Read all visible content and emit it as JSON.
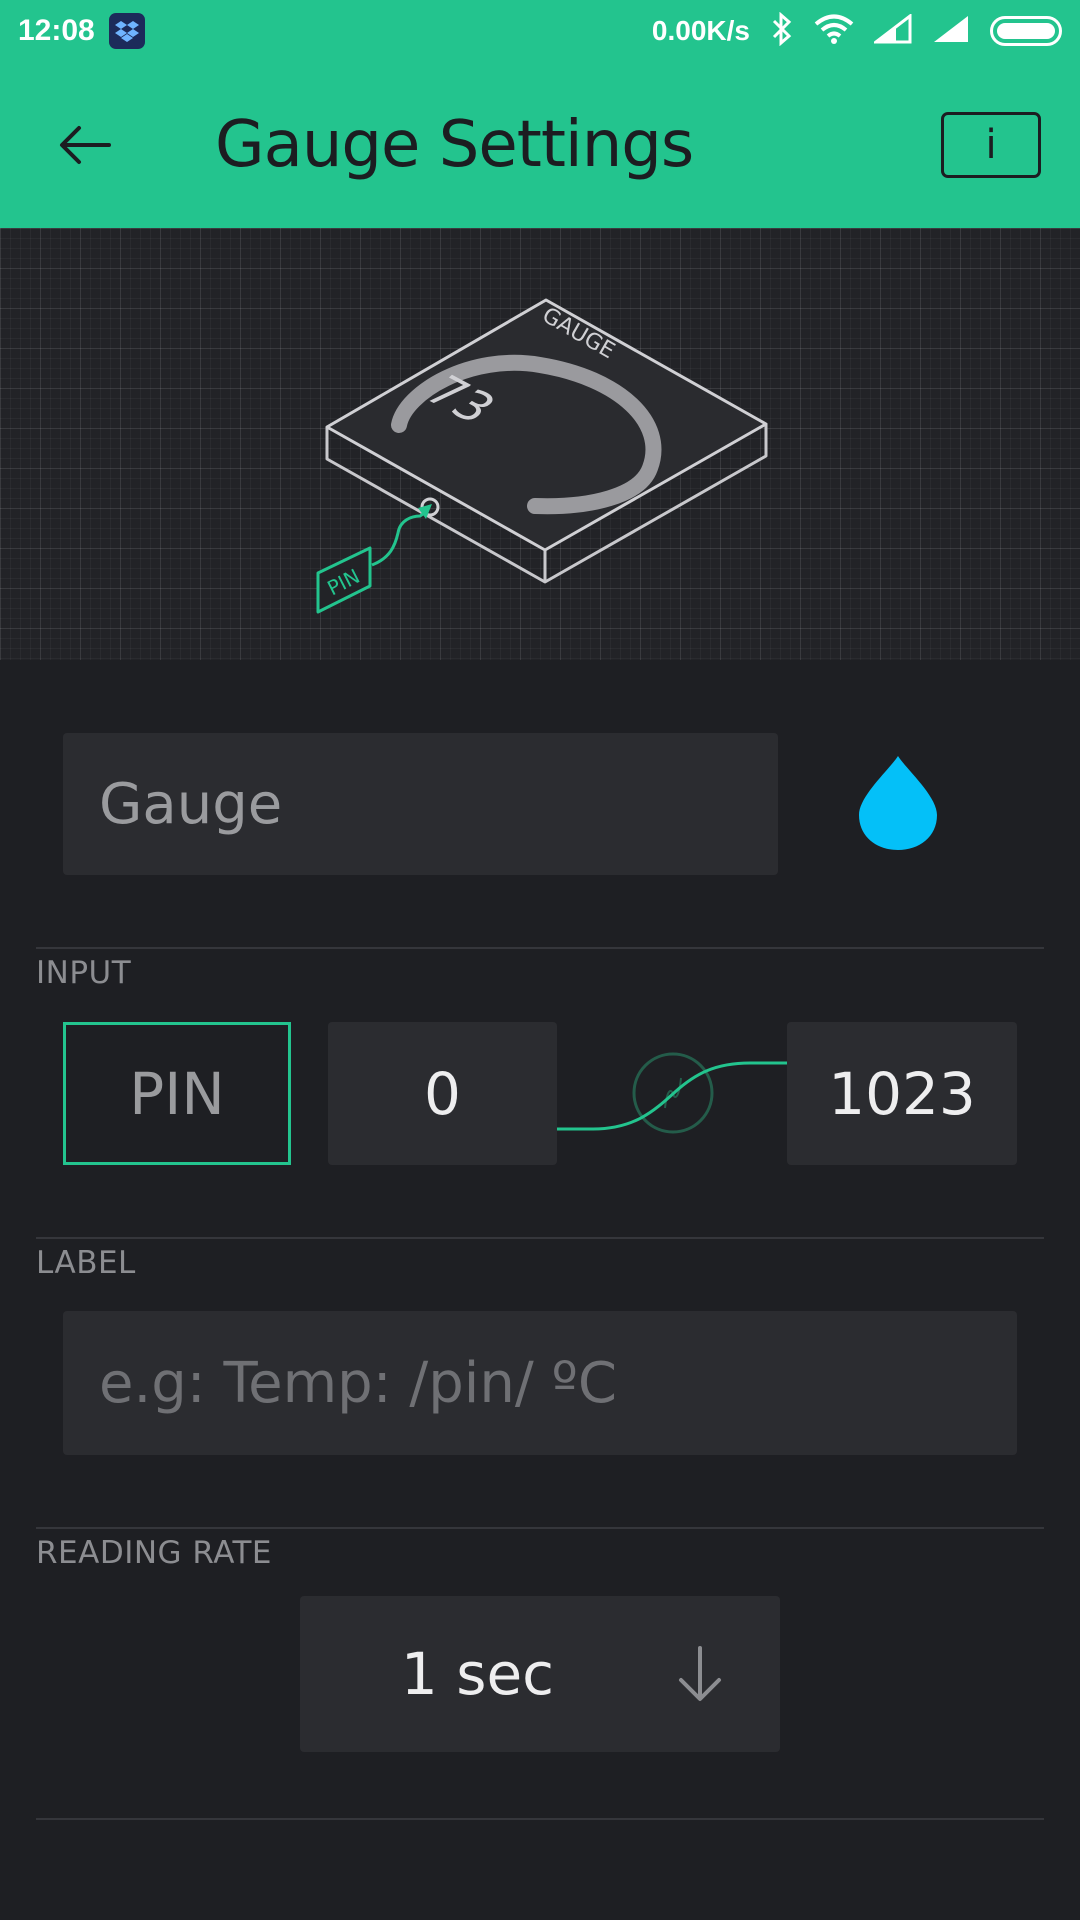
{
  "status_bar": {
    "time": "12:08",
    "app_icon": "dropbox-icon",
    "net_speed": "0.00K/s",
    "icons": [
      "bluetooth-icon",
      "wifi-icon",
      "signal-icon",
      "signal-icon",
      "battery-icon"
    ]
  },
  "app_bar": {
    "title": "Gauge Settings",
    "back_icon": "arrow-left-icon",
    "info_label": "i",
    "background": "#23c48e"
  },
  "preview": {
    "widget_name": "GAUGE",
    "gauge_value": "73",
    "pin_tag": "PIN"
  },
  "name_field": {
    "value": "Gauge",
    "color_icon": "droplet-icon",
    "color": "#04c0f8"
  },
  "input_section": {
    "label": "INPUT",
    "pin_label": "PIN",
    "min_value": "0",
    "max_value": "1023",
    "accent": "#23c48e"
  },
  "label_section": {
    "label": "LABEL",
    "placeholder": "e.g: Temp: /pin/ ºC"
  },
  "reading_rate": {
    "label": "READING RATE",
    "value": "1 sec",
    "arrow_icon": "arrow-down-icon"
  }
}
